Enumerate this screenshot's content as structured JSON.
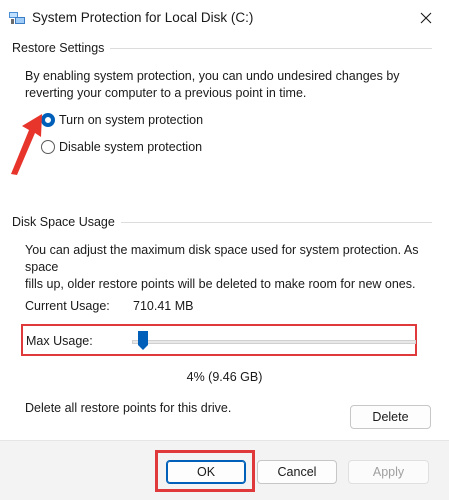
{
  "window": {
    "title": "System Protection for Local Disk (C:)",
    "close_glyph": "✕"
  },
  "restore_settings": {
    "section_title": "Restore Settings",
    "description_line1": "By enabling system protection, you can undo undesired changes by",
    "description_line2": "reverting your computer to a previous point in time.",
    "options": [
      {
        "label": "Turn on system protection",
        "checked": true
      },
      {
        "label": "Disable system protection",
        "checked": false
      }
    ]
  },
  "disk_space": {
    "section_title": "Disk Space Usage",
    "description_line1": "You can adjust the maximum disk space used for system protection. As space",
    "description_line2": "fills up, older restore points will be deleted to make room for new ones.",
    "current_usage_label": "Current Usage:",
    "current_usage_value": "710.41 MB",
    "max_usage_label": "Max Usage:",
    "max_usage_percent": 4,
    "max_usage_text": "4% (9.46 GB)",
    "delete_description": "Delete all restore points for this drive.",
    "delete_button": "Delete"
  },
  "buttons": {
    "ok": "OK",
    "cancel": "Cancel",
    "apply": "Apply"
  },
  "colors": {
    "accent": "#005fb8",
    "annotation_red": "#e0393b"
  }
}
